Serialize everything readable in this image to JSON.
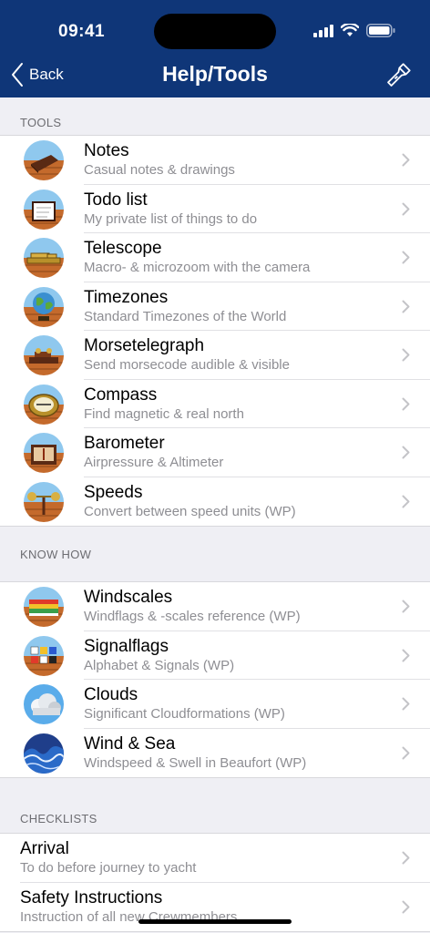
{
  "status": {
    "time": "09:41"
  },
  "nav": {
    "back_label": "Back",
    "title": "Help/Tools",
    "tool_icon": "flashlight-icon"
  },
  "colors": {
    "nav_bg": "#0f3678",
    "list_bg": "#ffffff",
    "group_bg": "#efeff4"
  },
  "sections": {
    "tools": {
      "header": "TOOLS",
      "items": [
        {
          "title": "Notes",
          "subtitle": "Casual notes & drawings",
          "icon": "notes-icon"
        },
        {
          "title": "Todo list",
          "subtitle": "My private list of things to do",
          "icon": "todo-icon"
        },
        {
          "title": "Telescope",
          "subtitle": "Macro- & microzoom with the camera",
          "icon": "telescope-icon"
        },
        {
          "title": "Timezones",
          "subtitle": "Standard Timezones of the World",
          "icon": "globe-icon"
        },
        {
          "title": "Morsetelegraph",
          "subtitle": "Send morsecode audible & visible",
          "icon": "telegraph-icon"
        },
        {
          "title": "Compass",
          "subtitle": "Find magnetic & real north",
          "icon": "compass-icon"
        },
        {
          "title": "Barometer",
          "subtitle": "Airpressure & Altimeter",
          "icon": "barometer-icon"
        },
        {
          "title": "Speeds",
          "subtitle": "Convert between speed units (WP)",
          "icon": "anemometer-icon"
        }
      ]
    },
    "knowhow": {
      "header": "KNOW HOW",
      "items": [
        {
          "title": "Windscales",
          "subtitle": "Windflags & -scales reference (WP)",
          "icon": "windscale-icon"
        },
        {
          "title": "Signalflags",
          "subtitle": "Alphabet & Signals (WP)",
          "icon": "signalflags-icon"
        },
        {
          "title": "Clouds",
          "subtitle": "Significant Cloudformations (WP)",
          "icon": "cloud-icon"
        },
        {
          "title": "Wind & Sea",
          "subtitle": "Windspeed & Swell in Beaufort (WP)",
          "icon": "waves-icon"
        }
      ]
    },
    "checklists": {
      "header": "CHECKLISTS",
      "items": [
        {
          "title": "Arrival",
          "subtitle": "To do before journey to yacht"
        },
        {
          "title": "Safety Instructions",
          "subtitle": "Instruction of all new Crewmembers"
        }
      ]
    }
  }
}
